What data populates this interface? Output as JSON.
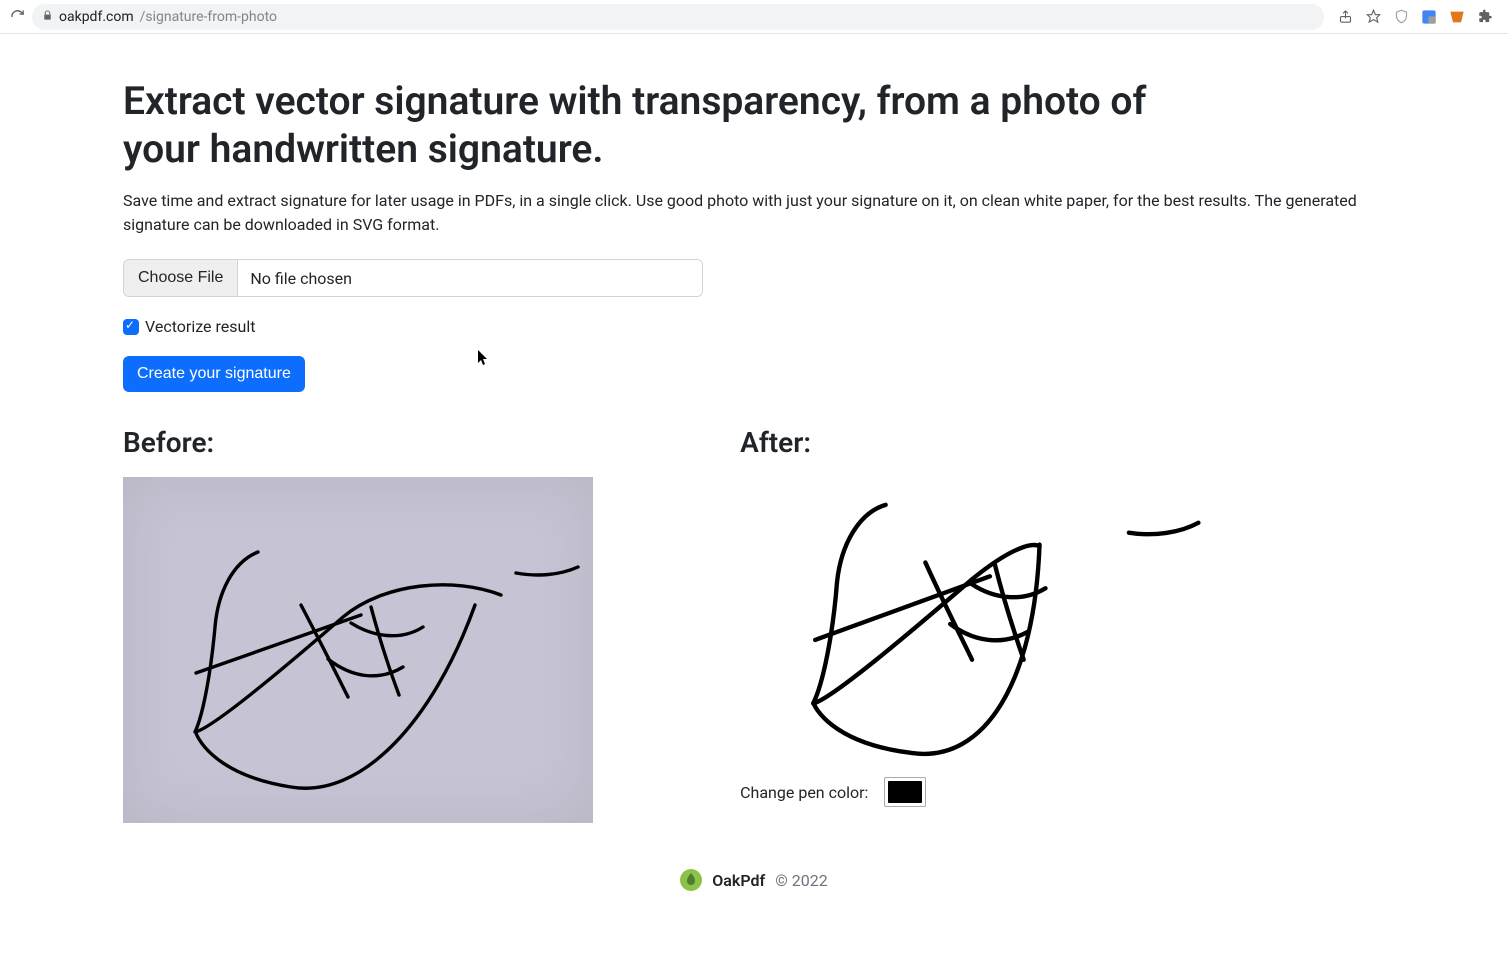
{
  "browser": {
    "domain": "oakpdf.com",
    "path": "/signature-from-photo"
  },
  "page": {
    "title": "Extract vector signature with transparency, from a photo of your handwritten signature.",
    "intro": "Save time and extract signature for later usage in PDFs, in a single click. Use good photo with just your signature on it, on clean white paper, for the best results. The generated signature can be downloaded in SVG format.",
    "file_button": "Choose File",
    "file_status": "No file chosen",
    "vectorize_label": "Vectorize result",
    "vectorize_checked": true,
    "create_button": "Create your signature",
    "before_heading": "Before:",
    "after_heading": "After:",
    "pen_label": "Change pen color:",
    "pen_color": "#000000"
  },
  "footer": {
    "brand": "OakPdf",
    "copyright": "© 2022"
  }
}
